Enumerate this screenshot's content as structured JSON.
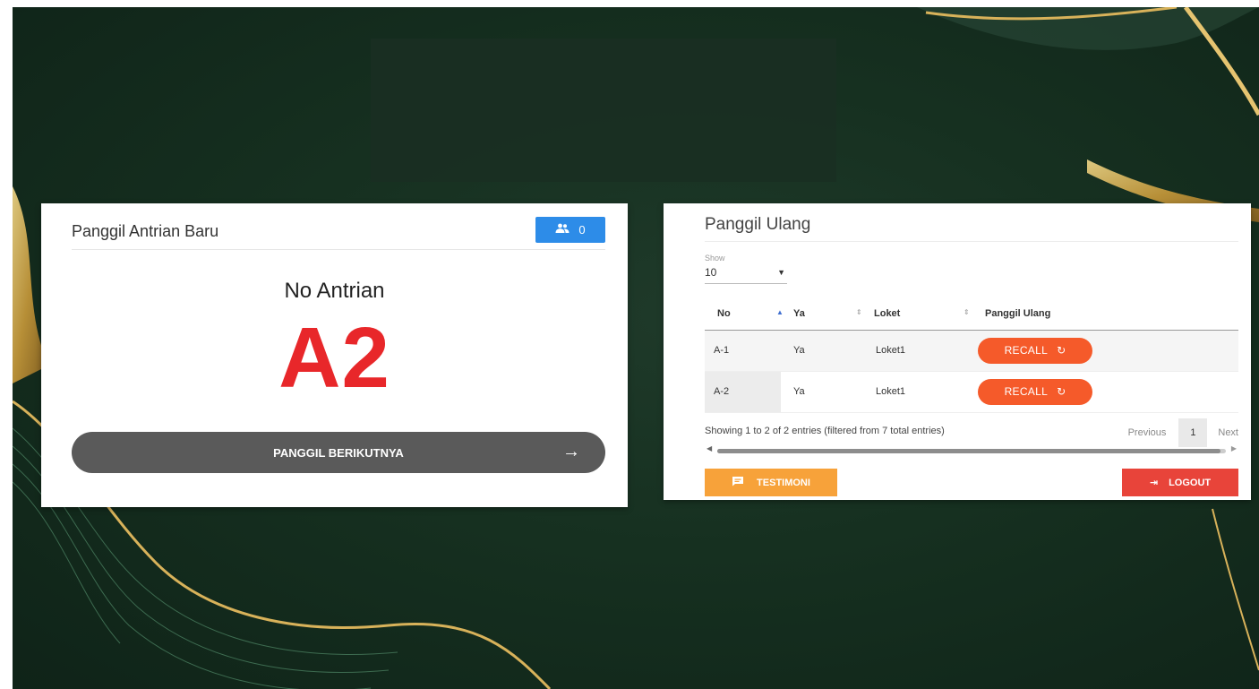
{
  "left_card": {
    "title": "Panggil Antrian Baru",
    "badge_icon": "people-icon",
    "badge_count": "0",
    "no_label": "No Antrian",
    "current_number": "A2",
    "next_button": "PANGGIL BERIKUTNYA",
    "next_icon": "arrow-right-icon"
  },
  "right_card": {
    "title": "Panggil Ulang",
    "show_label": "Show",
    "show_value": "10",
    "columns": [
      "No",
      "Ya",
      "Loket",
      "Panggil Ulang"
    ],
    "rows": [
      {
        "no": "A-1",
        "ya": "Ya",
        "loket": "Loket1",
        "action": "RECALL"
      },
      {
        "no": "A-2",
        "ya": "Ya",
        "loket": "Loket1",
        "action": "RECALL"
      }
    ],
    "info": "Showing 1 to 2 of 2 entries (filtered from 7 total entries)",
    "pager": {
      "previous": "Previous",
      "page": "1",
      "next": "Next"
    },
    "testimoni_button": "TESTIMONI",
    "logout_button": "LOGOUT"
  },
  "colors": {
    "accent_blue": "#2d8ce8",
    "number_red": "#e8272a",
    "recall_orange": "#f55a2a",
    "testimoni_orange": "#f7a23a",
    "logout_red": "#e8443a",
    "background_green": "#163020"
  }
}
